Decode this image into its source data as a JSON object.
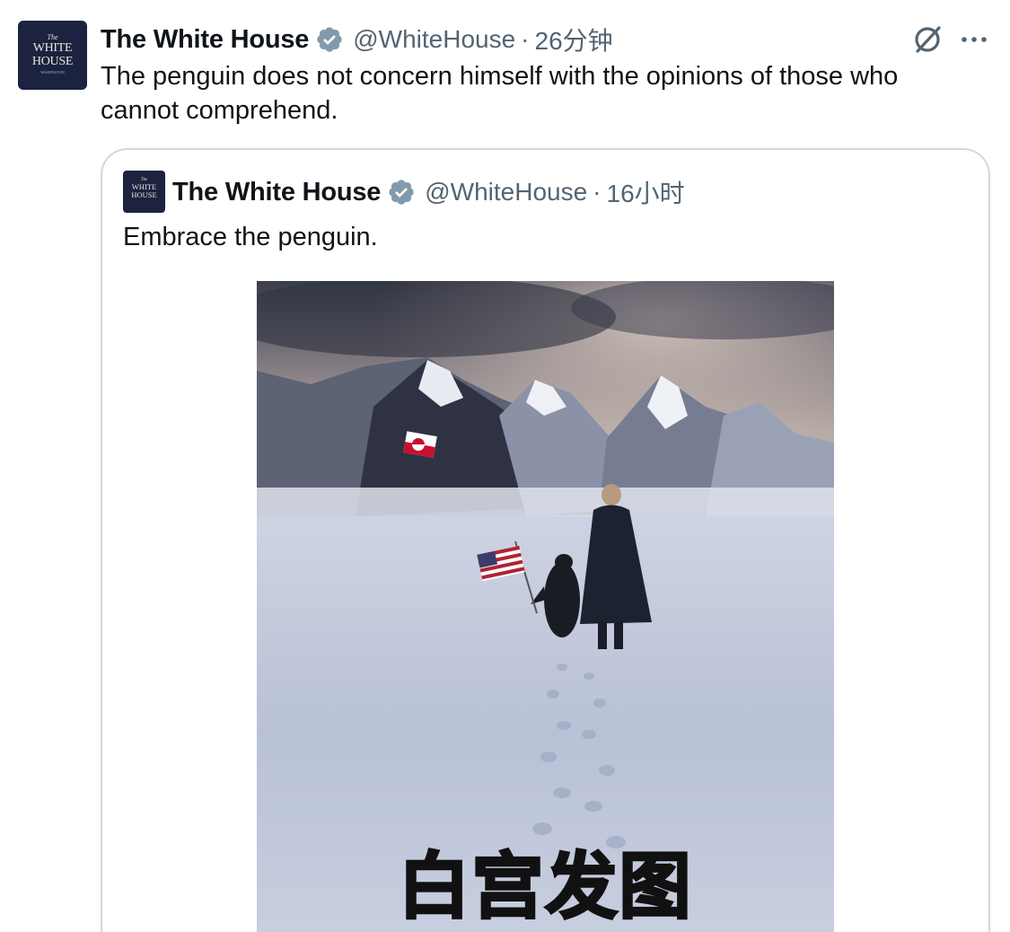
{
  "tweet": {
    "author_name": "The White House",
    "handle": "@WhiteHouse",
    "separator": "·",
    "time": "26分钟",
    "text": "The penguin does not concern himself with the opinions of those who cannot comprehend.",
    "avatar": {
      "line1": "The",
      "line2": "WHITE",
      "line3": "HOUSE",
      "line4": "WASHINGTON"
    }
  },
  "quoted_tweet": {
    "author_name": "The White House",
    "handle": "@WhiteHouse",
    "separator": "·",
    "time": "16小时",
    "text": "Embrace the penguin.",
    "avatar": {
      "line1": "The",
      "line2": "WHITE",
      "line3": "HOUSE"
    },
    "image": {
      "caption": "白宫发图"
    }
  },
  "icons": {
    "verified": "verified-badge-icon",
    "grok": "grok-icon",
    "more": "more-options-icon"
  },
  "colors": {
    "text": "#0f1419",
    "secondary": "#536471",
    "border": "#cfd9de",
    "avatar_bg": "#1b2340",
    "badge": "#829aab"
  }
}
